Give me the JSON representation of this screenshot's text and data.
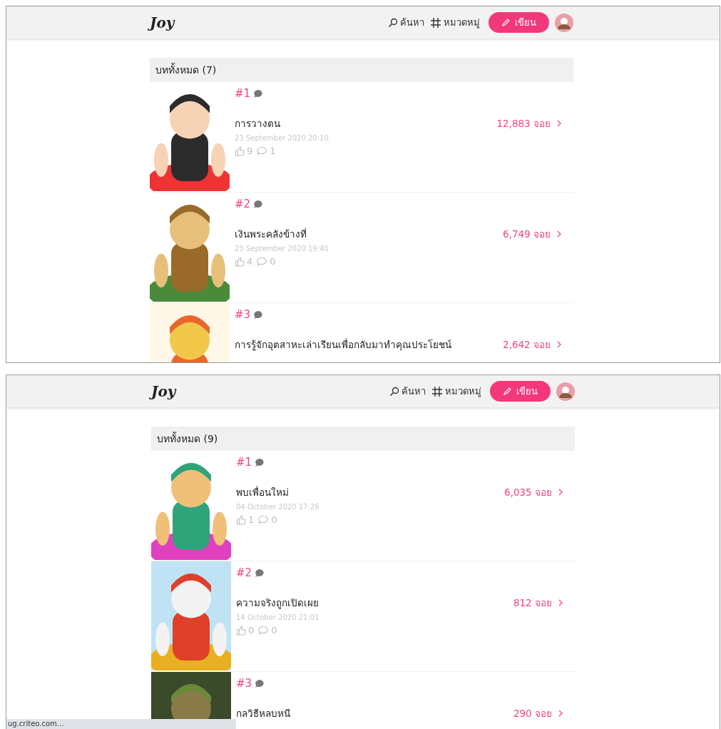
{
  "screens": [
    {
      "logo": "Joy",
      "nav": [
        {
          "kind": "search",
          "label": "ค้นหา"
        },
        {
          "kind": "category",
          "label": "หมวดหมู่"
        }
      ],
      "write_button": "เขียน",
      "section_title": "บททั้งหมด (7)",
      "rows": [
        {
          "rank": "#1",
          "title": "การวางตน",
          "views": "12,883 จอย",
          "date": "23 September 2020 20:10",
          "likes": "9",
          "comments": "1"
        },
        {
          "rank": "#2",
          "title": "เงินพระคลังข้างที่",
          "views": "6,749 จอย",
          "date": "23 September 2020 19:40",
          "likes": "4",
          "comments": "0"
        },
        {
          "rank": "#3",
          "title": "การรู้จักอุตสาหะเล่าเรียนเพื่อกลับมาทำคุณประโยชน์",
          "views": "2,642 จอย"
        }
      ]
    },
    {
      "logo": "Joy",
      "nav": [
        {
          "kind": "search",
          "label": "ค้นหา"
        },
        {
          "kind": "category",
          "label": "หมวดหมู่"
        }
      ],
      "write_button": "เขียน",
      "section_title": "บททั้งหมด (9)",
      "rows": [
        {
          "rank": "#1",
          "title": "พบเพื่อนใหม่",
          "views": "6,035 จอย",
          "date": "04 October 2020 17:26",
          "likes": "1",
          "comments": "0"
        },
        {
          "rank": "#2",
          "title": "ความจริงถูกเปิดเผย",
          "views": "812 จอย",
          "date": "14 October 2020 21:01",
          "likes": "0",
          "comments": "0"
        },
        {
          "rank": "#3",
          "title": "กลวิธีหลบหนี",
          "views": "290 จอย"
        }
      ],
      "status_bar": "ug.criteo.com..."
    }
  ]
}
